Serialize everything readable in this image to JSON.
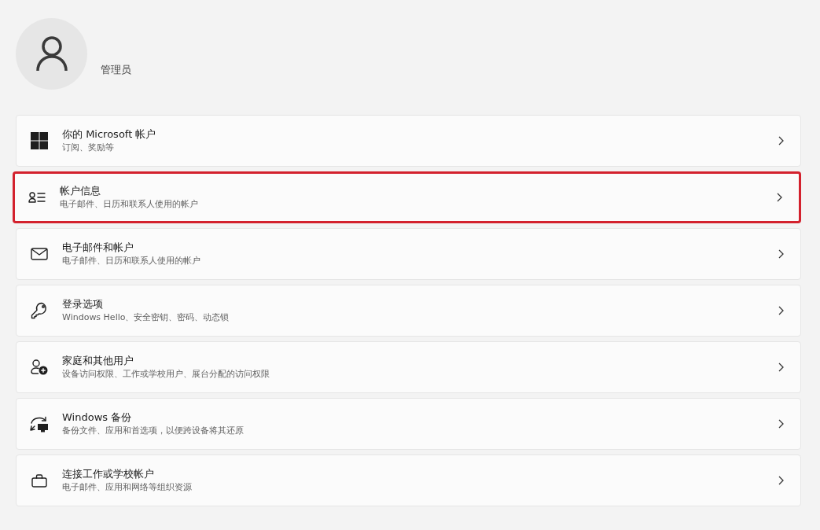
{
  "user": {
    "name": "管理员"
  },
  "items": [
    {
      "kind": "microsoft",
      "title": "你的 Microsoft 帐户",
      "subtitle": "订阅、奖励等",
      "highlighted": false
    },
    {
      "kind": "info",
      "title": "帐户信息",
      "subtitle": "电子邮件、日历和联系人使用的帐户",
      "highlighted": true
    },
    {
      "kind": "mail",
      "title": "电子邮件和帐户",
      "subtitle": "电子邮件、日历和联系人使用的帐户",
      "highlighted": false
    },
    {
      "kind": "key",
      "title": "登录选项",
      "subtitle": "Windows Hello、安全密钥、密码、动态锁",
      "highlighted": false
    },
    {
      "kind": "family",
      "title": "家庭和其他用户",
      "subtitle": "设备访问权限、工作或学校用户、展台分配的访问权限",
      "highlighted": false
    },
    {
      "kind": "backup",
      "title": "Windows 备份",
      "subtitle": "备份文件、应用和首选项，以便跨设备将其还原",
      "highlighted": false
    },
    {
      "kind": "work",
      "title": "连接工作或学校帐户",
      "subtitle": "电子邮件、应用和网络等组织资源",
      "highlighted": false
    }
  ]
}
